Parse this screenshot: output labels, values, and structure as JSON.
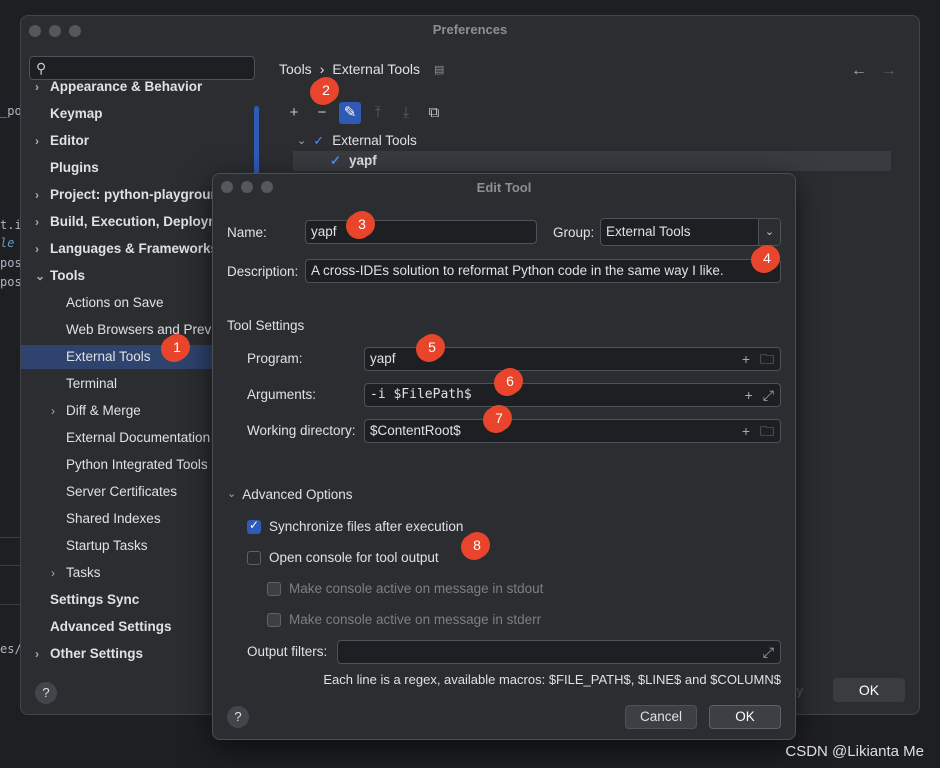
{
  "background": {
    "code_lines": [
      "_po",
      "t.i",
      " le",
      "pos",
      "pos",
      "es/"
    ]
  },
  "watermark": "CSDN @Likianta Me",
  "preferences": {
    "title": "Preferences",
    "breadcrumb": {
      "root": "Tools",
      "separator": "›",
      "current": "External Tools"
    },
    "sidebar": [
      {
        "label": "Appearance & Behavior",
        "bold": true,
        "chevron": "›"
      },
      {
        "label": "Keymap",
        "bold": true,
        "chevron": ""
      },
      {
        "label": "Editor",
        "bold": true,
        "chevron": "›"
      },
      {
        "label": "Plugins",
        "bold": true,
        "chevron": ""
      },
      {
        "label": "Project: python-playground",
        "bold": true,
        "chevron": "›"
      },
      {
        "label": "Build, Execution, Deployment",
        "bold": true,
        "chevron": "›"
      },
      {
        "label": "Languages & Frameworks",
        "bold": true,
        "chevron": "›"
      },
      {
        "label": "Tools",
        "bold": true,
        "chevron": "⌄"
      },
      {
        "label": "Actions on Save",
        "bold": false,
        "chevron": ""
      },
      {
        "label": "Web Browsers and Preview",
        "bold": false,
        "chevron": ""
      },
      {
        "label": "External Tools",
        "bold": false,
        "chevron": "",
        "selected": true
      },
      {
        "label": "Terminal",
        "bold": false,
        "chevron": ""
      },
      {
        "label": "Diff & Merge",
        "bold": false,
        "chevron": "›"
      },
      {
        "label": "External Documentation",
        "bold": false,
        "chevron": ""
      },
      {
        "label": "Python Integrated Tools",
        "bold": false,
        "chevron": ""
      },
      {
        "label": "Server Certificates",
        "bold": false,
        "chevron": ""
      },
      {
        "label": "Shared Indexes",
        "bold": false,
        "chevron": ""
      },
      {
        "label": "Startup Tasks",
        "bold": false,
        "chevron": ""
      },
      {
        "label": "Tasks",
        "bold": false,
        "chevron": "›"
      },
      {
        "label": "Settings Sync",
        "bold": true,
        "chevron": ""
      },
      {
        "label": "Advanced Settings",
        "bold": true,
        "chevron": ""
      },
      {
        "label": "Other Settings",
        "bold": true,
        "chevron": "›"
      }
    ],
    "toolbar": {
      "add": "+",
      "remove": "−",
      "edit": "✎",
      "move_up": "⤒",
      "move_down": "⤓",
      "copy": "⧉"
    },
    "tree": {
      "group_label": "External Tools",
      "tool_label": "yapf"
    },
    "help": "?",
    "ok_label": "OK",
    "dim_text": "y"
  },
  "dialog": {
    "title": "Edit Tool",
    "name_label": "Name:",
    "name_value": "yapf",
    "group_label": "Group:",
    "group_value": "External Tools",
    "description_label": "Description:",
    "description_value": "A cross-IDEs solution to reformat Python code in the same way I like.",
    "tool_settings_label": "Tool Settings",
    "program_label": "Program:",
    "program_value": "yapf",
    "arguments_label": "Arguments:",
    "arguments_value": "-i $FilePath$",
    "workdir_label": "Working directory:",
    "workdir_value": "$ContentRoot$",
    "advanced_label": "Advanced Options",
    "sync_label": "Synchronize files after execution",
    "sync_checked": true,
    "console_label": "Open console for tool output",
    "console_checked": false,
    "stdout_label": "Make console active on message in stdout",
    "stderr_label": "Make console active on message in stderr",
    "output_filters_label": "Output filters:",
    "output_filters_value": "",
    "hint": "Each line is a regex, available macros: $FILE_PATH$, $LINE$ and $COLUMN$",
    "cancel_label": "Cancel",
    "ok_label": "OK",
    "help": "?"
  },
  "annotations": [
    "1",
    "2",
    "3",
    "4",
    "5",
    "6",
    "7",
    "8"
  ],
  "colors": {
    "accent": "#2f5bb7",
    "selection": "#2e436e",
    "badge": "#e8452c"
  }
}
